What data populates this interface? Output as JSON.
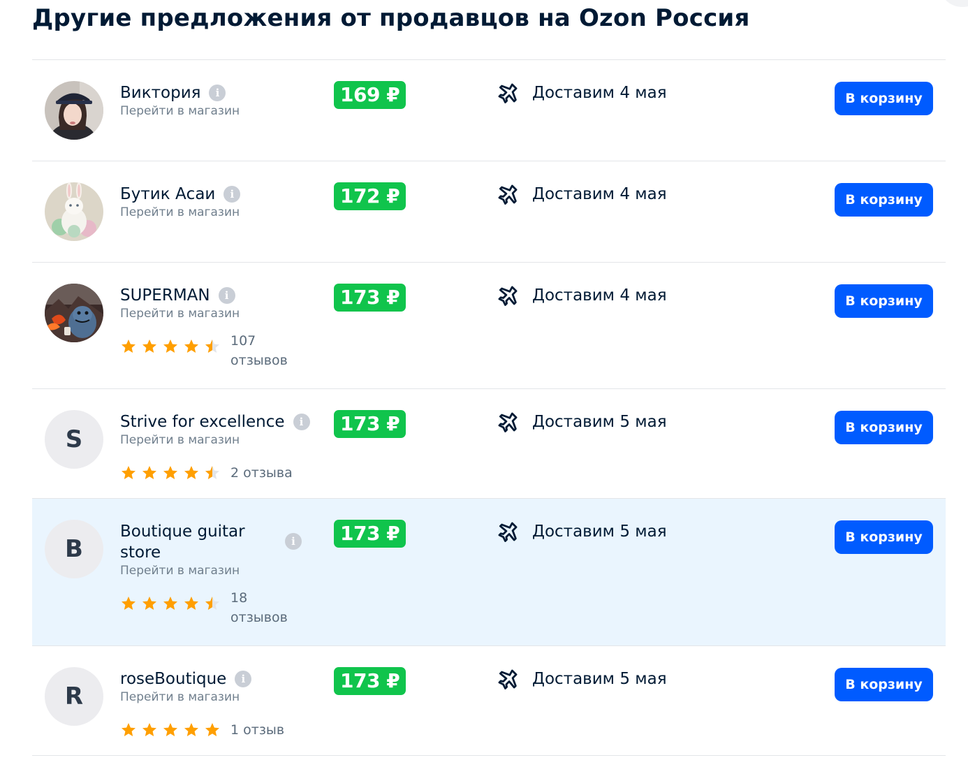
{
  "page": {
    "title": "Другие предложения от продавцов на Ozon Россия"
  },
  "colors": {
    "price_badge": "#10c44c",
    "cart_button": "#005bff",
    "star": "#ff9f00",
    "highlight_row": "#eaf5fe"
  },
  "sellers": [
    {
      "name": "Виктория",
      "shop_link": "Перейти в магазин",
      "avatar": "photo-girl-cap",
      "price": "169 ₽",
      "delivery": "Доставим 4 мая",
      "button": "В корзину"
    },
    {
      "name": "Бутик Асаи",
      "shop_link": "Перейти в магазин",
      "avatar": "photo-bunny",
      "price": "172 ₽",
      "delivery": "Доставим 4 мая",
      "button": "В корзину"
    },
    {
      "name": "SUPERMAN",
      "shop_link": "Перейти в магазин",
      "avatar": "photo-monster-volcano",
      "price": "173 ₽",
      "delivery": "Доставим 4 мая",
      "button": "В корзину",
      "rating": 4.5,
      "reviews": "107 отзывов"
    },
    {
      "name": "Strive for excellence",
      "shop_link": "Перейти в магазин",
      "avatar_letter": "S",
      "price": "173 ₽",
      "delivery": "Доставим 5 мая",
      "button": "В корзину",
      "rating": 4.5,
      "reviews": "2 отзыва"
    },
    {
      "name": "Boutique guitar store",
      "shop_link": "Перейти в магазин",
      "avatar_letter": "B",
      "price": "173 ₽",
      "delivery": "Доставим 5 мая",
      "button": "В корзину",
      "rating": 4.5,
      "reviews": "18 отзывов",
      "highlighted": true
    },
    {
      "name": "roseBoutique",
      "shop_link": "Перейти в магазин",
      "avatar_letter": "R",
      "price": "173 ₽",
      "delivery": "Доставим 5 мая",
      "button": "В корзину",
      "rating": 5,
      "reviews": "1 отзыв"
    }
  ]
}
